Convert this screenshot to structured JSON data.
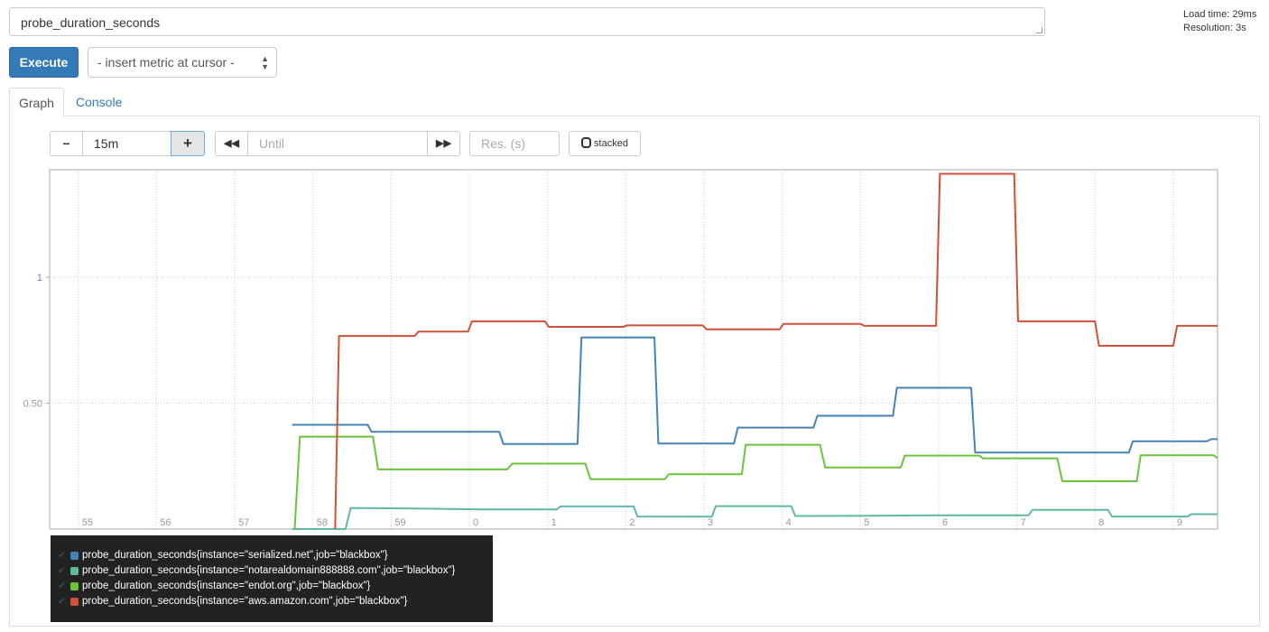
{
  "query": {
    "expression": "probe_duration_seconds"
  },
  "stats": {
    "load_time": "Load time: 29ms",
    "resolution": "Resolution: 3s"
  },
  "toolbar": {
    "execute_label": "Execute",
    "insert_metric": "- insert metric at cursor -"
  },
  "tabs": [
    {
      "label": "Graph",
      "active": true
    },
    {
      "label": "Console",
      "active": false
    }
  ],
  "graph_controls": {
    "range_minus": "−",
    "range_value": "15m",
    "range_plus": "+",
    "back_icon": "double-left-arrow",
    "until_placeholder": "Until",
    "forward_icon": "double-right-arrow",
    "resolution_placeholder": "Res. (s)",
    "stacked_label": "stacked"
  },
  "chart_data": {
    "type": "line",
    "line_shape": "step",
    "xlim": [
      "54:38",
      "09:34"
    ],
    "ylim": [
      0,
      1.427
    ],
    "x_ticks": [
      "55",
      "56",
      "57",
      "58",
      "59",
      "0",
      "1",
      "2",
      "3",
      "4",
      "5",
      "6",
      "7",
      "8",
      "9"
    ],
    "y_ticks": [
      {
        "value": 0.5,
        "label": "0.50"
      },
      {
        "value": 1,
        "label": "1"
      }
    ],
    "grid": true,
    "legend_placement": "bottom",
    "series": [
      {
        "name": "probe_duration_seconds{instance=\"serialized.net\",job=\"blackbox\"}",
        "color": "#4682b4",
        "points": [
          [
            "57:44",
            0.414
          ],
          [
            "58:42",
            0.414
          ],
          [
            "58:45",
            0.386
          ],
          [
            "00:23",
            0.386
          ],
          [
            "00:26",
            0.338
          ],
          [
            "01:23",
            0.338
          ],
          [
            "01:26",
            0.761
          ],
          [
            "02:22",
            0.761
          ],
          [
            "02:25",
            0.34
          ],
          [
            "03:23",
            0.34
          ],
          [
            "03:26",
            0.403
          ],
          [
            "04:24",
            0.403
          ],
          [
            "04:27",
            0.45
          ],
          [
            "05:25",
            0.45
          ],
          [
            "05:28",
            0.561
          ],
          [
            "06:25",
            0.561
          ],
          [
            "06:28",
            0.304
          ],
          [
            "08:26",
            0.304
          ],
          [
            "08:29",
            0.349
          ],
          [
            "09:26",
            0.349
          ],
          [
            "09:29",
            0.357
          ],
          [
            "09:34",
            0.357
          ]
        ]
      },
      {
        "name": "probe_duration_seconds{instance=\"notarealdomain888888.com\",job=\"blackbox\"}",
        "color": "#5fb8a6",
        "points": [
          [
            "57:44",
            0
          ],
          [
            "58:25",
            0
          ],
          [
            "58:29",
            0.084
          ],
          [
            "59:28",
            0.081
          ],
          [
            "00:09",
            0.078
          ],
          [
            "01:07",
            0.078
          ],
          [
            "01:10",
            0.09
          ],
          [
            "02:06",
            0.09
          ],
          [
            "02:09",
            0.05
          ],
          [
            "03:06",
            0.049
          ],
          [
            "03:09",
            0.091
          ],
          [
            "04:07",
            0.091
          ],
          [
            "04:10",
            0.052
          ],
          [
            "05:10",
            0.053
          ],
          [
            "06:10",
            0.055
          ],
          [
            "07:09",
            0.055
          ],
          [
            "07:12",
            0.076
          ],
          [
            "08:10",
            0.076
          ],
          [
            "08:13",
            0.05
          ],
          [
            "09:11",
            0.05
          ],
          [
            "09:14",
            0.059
          ],
          [
            "09:34",
            0.059
          ]
        ]
      },
      {
        "name": "probe_duration_seconds{instance=\"endot.org\",job=\"blackbox\"}",
        "color": "#6cc43a",
        "points": [
          [
            "57:46",
            0
          ],
          [
            "57:50",
            0.367
          ],
          [
            "58:46",
            0.367
          ],
          [
            "58:50",
            0.237
          ],
          [
            "00:29",
            0.237
          ],
          [
            "00:33",
            0.26
          ],
          [
            "01:29",
            0.26
          ],
          [
            "01:33",
            0.198
          ],
          [
            "02:30",
            0.198
          ],
          [
            "02:33",
            0.218
          ],
          [
            "03:29",
            0.218
          ],
          [
            "03:32",
            0.335
          ],
          [
            "04:29",
            0.335
          ],
          [
            "04:33",
            0.245
          ],
          [
            "05:31",
            0.245
          ],
          [
            "05:34",
            0.292
          ],
          [
            "06:31",
            0.292
          ],
          [
            "06:34",
            0.281
          ],
          [
            "07:31",
            0.281
          ],
          [
            "07:35",
            0.19
          ],
          [
            "08:32",
            0.19
          ],
          [
            "08:35",
            0.293
          ],
          [
            "09:31",
            0.293
          ],
          [
            "09:34",
            0.282
          ]
        ]
      },
      {
        "name": "probe_duration_seconds{instance=\"aws.amazon.com\",job=\"blackbox\"}",
        "color": "#d0503a",
        "points": [
          [
            "58:17",
            0
          ],
          [
            "58:20",
            0.767
          ],
          [
            "59:18",
            0.767
          ],
          [
            "59:21",
            0.784
          ],
          [
            "59:59",
            0.784
          ],
          [
            "00:02",
            0.825
          ],
          [
            "00:58",
            0.825
          ],
          [
            "01:01",
            0.803
          ],
          [
            "01:58",
            0.803
          ],
          [
            "02:01",
            0.809
          ],
          [
            "02:59",
            0.809
          ],
          [
            "03:02",
            0.793
          ],
          [
            "03:58",
            0.793
          ],
          [
            "04:01",
            0.815
          ],
          [
            "05:00",
            0.815
          ],
          [
            "05:03",
            0.807
          ],
          [
            "05:58",
            0.807
          ],
          [
            "06:01",
            1.411
          ],
          [
            "06:58",
            1.411
          ],
          [
            "07:01",
            0.825
          ],
          [
            "08:00",
            0.825
          ],
          [
            "08:03",
            0.728
          ],
          [
            "09:00",
            0.728
          ],
          [
            "09:03",
            0.807
          ],
          [
            "09:34",
            0.807
          ]
        ]
      }
    ]
  }
}
